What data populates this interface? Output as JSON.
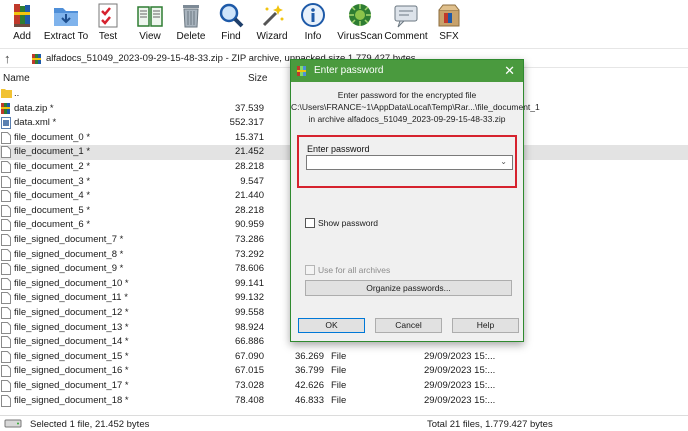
{
  "toolbar": {
    "buttons": [
      {
        "label": "Add",
        "icon": "books-stack-icon"
      },
      {
        "label": "Extract To",
        "icon": "folder-extract-icon"
      },
      {
        "label": "Test",
        "icon": "checklist-icon"
      },
      {
        "label": "View",
        "icon": "open-book-icon"
      },
      {
        "label": "Delete",
        "icon": "trash-can-icon"
      },
      {
        "label": "Find",
        "icon": "magnifier-icon"
      },
      {
        "label": "Wizard",
        "icon": "magic-wand-icon"
      },
      {
        "label": "Info",
        "icon": "info-icon"
      },
      {
        "label": "VirusScan",
        "icon": "virus-icon"
      },
      {
        "label": "Comment",
        "icon": "comment-icon"
      },
      {
        "label": "SFX",
        "icon": "sfx-box-icon"
      }
    ]
  },
  "address": {
    "path": "alfadocs_51049_2023-09-29-15-48-33.zip - ZIP archive, unpacked size 1,779,427 bytes"
  },
  "columns": {
    "name": "Name",
    "size": "Size"
  },
  "files": [
    {
      "name": "..",
      "size": "",
      "packed": "",
      "type": "",
      "modified": "",
      "icon": "folder-icon"
    },
    {
      "name": "data.zip *",
      "size": "37.539",
      "packed": "",
      "type": "",
      "modified": "",
      "icon": "archive-icon"
    },
    {
      "name": "data.xml *",
      "size": "552.317",
      "packed": "",
      "type": "",
      "modified": "",
      "icon": "xml-file-icon"
    },
    {
      "name": "file_document_0 *",
      "size": "15.371",
      "packed": "",
      "type": "",
      "modified": "",
      "icon": "file-icon"
    },
    {
      "name": "file_document_1 *",
      "size": "21.452",
      "packed": "",
      "type": "",
      "modified": "",
      "icon": "file-icon"
    },
    {
      "name": "file_document_2 *",
      "size": "28.218",
      "packed": "",
      "type": "",
      "modified": "",
      "icon": "file-icon"
    },
    {
      "name": "file_document_3 *",
      "size": "9.547",
      "packed": "",
      "type": "",
      "modified": "",
      "icon": "file-icon"
    },
    {
      "name": "file_document_4 *",
      "size": "21.440",
      "packed": "",
      "type": "",
      "modified": "",
      "icon": "file-icon"
    },
    {
      "name": "file_document_5 *",
      "size": "28.218",
      "packed": "",
      "type": "",
      "modified": "",
      "icon": "file-icon"
    },
    {
      "name": "file_document_6 *",
      "size": "90.959",
      "packed": "",
      "type": "",
      "modified": "",
      "icon": "file-icon"
    },
    {
      "name": "file_signed_document_7 *",
      "size": "73.286",
      "packed": "",
      "type": "",
      "modified": "",
      "icon": "file-icon"
    },
    {
      "name": "file_signed_document_8 *",
      "size": "73.292",
      "packed": "",
      "type": "",
      "modified": "",
      "icon": "file-icon"
    },
    {
      "name": "file_signed_document_9 *",
      "size": "78.606",
      "packed": "",
      "type": "",
      "modified": "",
      "icon": "file-icon"
    },
    {
      "name": "file_signed_document_10 *",
      "size": "99.141",
      "packed": "",
      "type": "",
      "modified": "",
      "icon": "file-icon"
    },
    {
      "name": "file_signed_document_11 *",
      "size": "99.132",
      "packed": "",
      "type": "",
      "modified": "",
      "icon": "file-icon"
    },
    {
      "name": "file_signed_document_12 *",
      "size": "99.558",
      "packed": "",
      "type": "",
      "modified": "",
      "icon": "file-icon"
    },
    {
      "name": "file_signed_document_13 *",
      "size": "98.924",
      "packed": "",
      "type": "",
      "modified": "",
      "icon": "file-icon"
    },
    {
      "name": "file_signed_document_14 *",
      "size": "66.886",
      "packed": "",
      "type": "",
      "modified": "",
      "icon": "file-icon"
    },
    {
      "name": "file_signed_document_15 *",
      "size": "67.090",
      "packed": "36.269",
      "type": "File",
      "modified": "29/09/2023 15:...",
      "icon": "file-icon"
    },
    {
      "name": "file_signed_document_16 *",
      "size": "67.015",
      "packed": "36.799",
      "type": "File",
      "modified": "29/09/2023 15:...",
      "icon": "file-icon"
    },
    {
      "name": "file_signed_document_17 *",
      "size": "73.028",
      "packed": "42.626",
      "type": "File",
      "modified": "29/09/2023 15:...",
      "icon": "file-icon"
    },
    {
      "name": "file_signed_document_18 *",
      "size": "78.408",
      "packed": "46.833",
      "type": "File",
      "modified": "29/09/2023 15:...",
      "icon": "file-icon"
    }
  ],
  "selected_index": 4,
  "status": {
    "left": "Selected 1 file, 21.452 bytes",
    "right": "Total 21 files, 1.779.427 bytes"
  },
  "dialog": {
    "title": "Enter password",
    "info_line1": "Enter password for the encrypted file",
    "info_line2": "C:\\Users\\FRANCE~1\\AppData\\Local\\Temp\\Rar...\\file_document_1",
    "info_line3": "in archive alfadocs_51049_2023-09-29-15-48-33.zip",
    "password_label": "Enter password",
    "password_value": "",
    "show_password_label": "Show password",
    "show_password_checked": false,
    "use_for_all_label": "Use for all archives",
    "use_for_all_checked": false,
    "use_for_all_enabled": false,
    "organize_label": "Organize passwords...",
    "ok_label": "OK",
    "cancel_label": "Cancel",
    "help_label": "Help",
    "accent_color": "#4a9a3e",
    "highlight_color": "#d6222e"
  }
}
